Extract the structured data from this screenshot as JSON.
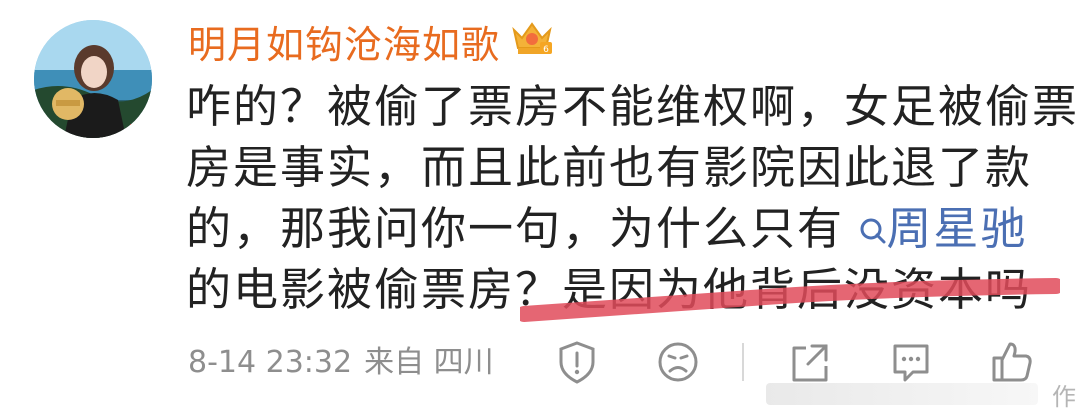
{
  "post": {
    "username": "明月如钩沧海如歌",
    "content_lines": [
      "咋的？被偷了票房不能维权啊，女足被偷票",
      "房是事实，而且此前也有影院因此退了款",
      "的，那我问你一句，为什么只有"
    ],
    "mention": "周星驰",
    "last_line_start": "的电影被偷票房？",
    "last_line_highlight": "是因为他背后没资本吗",
    "date": "8-14 23:32",
    "source": "来自 四川"
  },
  "watermark": {
    "text": "作"
  },
  "icons": [
    "avatar",
    "crown-badge-icon",
    "search-icon",
    "report-icon",
    "dislike-icon",
    "share-icon",
    "comment-icon",
    "like-icon"
  ],
  "colors": {
    "username": "#e86b1f",
    "mention": "#4b6fb3",
    "highlight": "#e14b5a",
    "meta": "#8e8e8e"
  }
}
